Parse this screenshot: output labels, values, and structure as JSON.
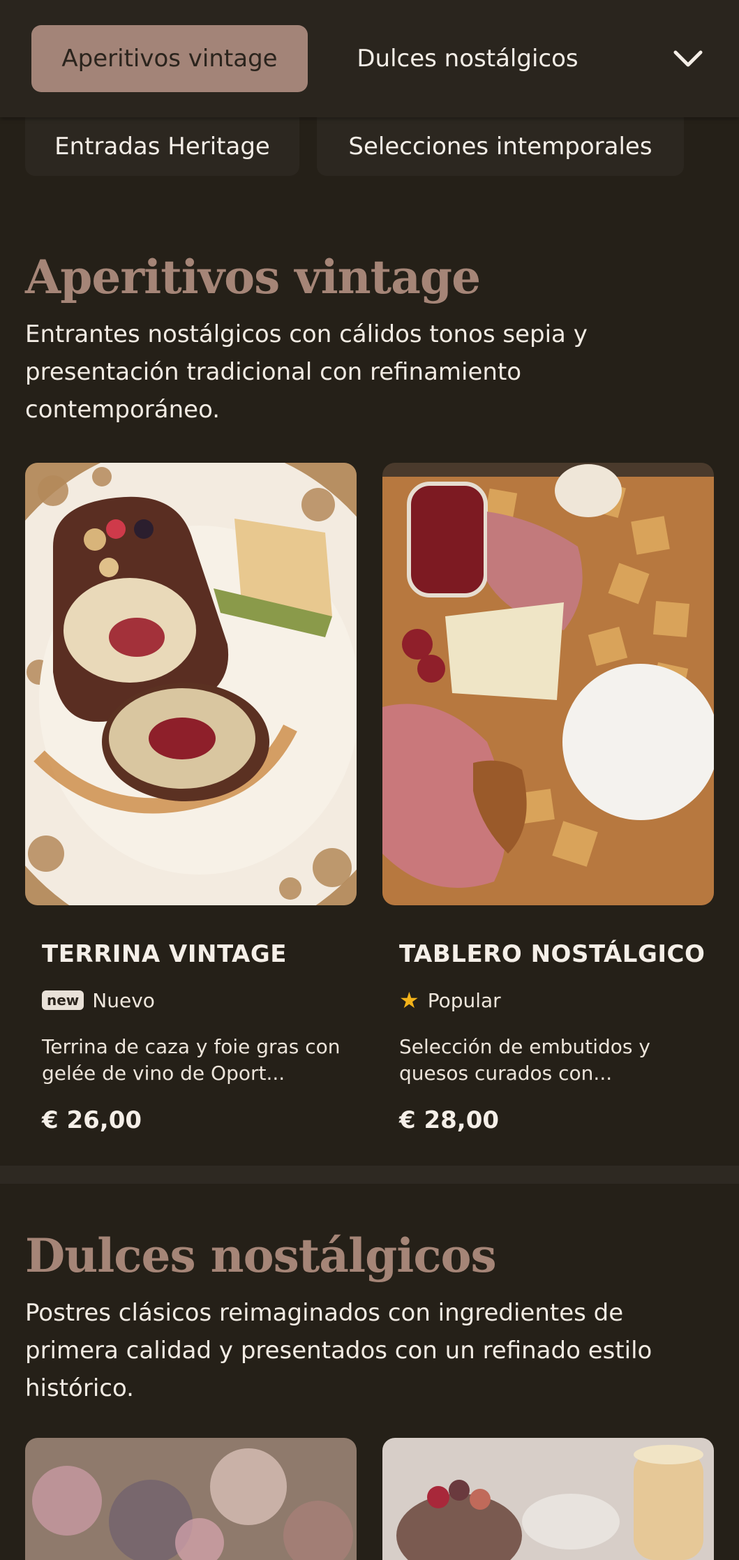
{
  "nav": {
    "tabs": [
      {
        "label": "Aperitivos vintage",
        "active": true
      },
      {
        "label": "Dulces nostálgicos",
        "active": false
      },
      {
        "label": "Entradas Heritage",
        "active": false
      },
      {
        "label": "Selecciones intemporales",
        "active": false
      }
    ],
    "expand_icon": "chevron-down-icon"
  },
  "sections": [
    {
      "title": "Aperitivos vintage",
      "description": "Entrantes nostálgicos con cálidos tonos sepia y presentación tradicional con refinamiento contemporáneo.",
      "items": [
        {
          "name": "TERRINA VINTAGE",
          "badge_icon": "new",
          "badge": "Nuevo",
          "description": "Terrina de caza y foie gras con gelée de vino de Oport...",
          "price": "€ 26,00"
        },
        {
          "name": "TABLERO NOSTÁLGICO",
          "badge_icon": "star-icon",
          "badge": "Popular",
          "description": "Selección de embutidos y quesos curados con...",
          "price": "€ 28,00"
        }
      ]
    },
    {
      "title": "Dulces nostálgicos",
      "description": "Postres clásicos reimaginados con ingredientes de primera calidad y presentados con un refinado estilo histórico."
    }
  ],
  "colors": {
    "background": "#252018",
    "accent": "#a38478",
    "heading": "#a58577",
    "star": "#f2b21a"
  }
}
